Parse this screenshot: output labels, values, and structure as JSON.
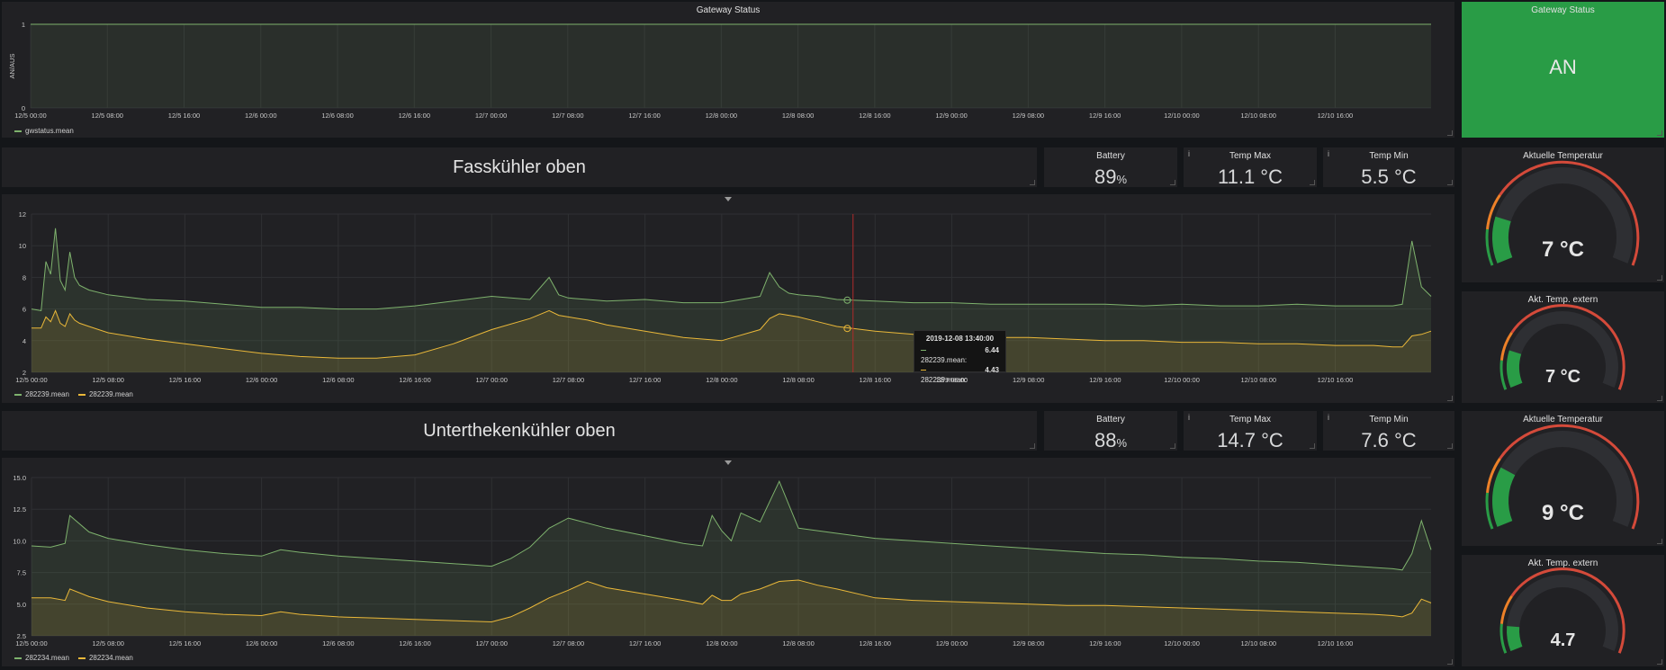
{
  "colors": {
    "green": "#7eb26d",
    "yellow": "#eab839",
    "gauge_red": "#d44a3a",
    "status_green": "#299c46"
  },
  "gateway_graph": {
    "title": "Gateway Status",
    "ylabel": "AN/AUS",
    "legend": [
      "gwstatus.mean"
    ]
  },
  "gateway_stat": {
    "title": "Gateway Status",
    "value": "AN"
  },
  "sections": [
    {
      "title": "Fasskühler oben",
      "battery": {
        "label": "Battery",
        "value": "89",
        "unit": "%"
      },
      "temp_max": {
        "label": "Temp Max",
        "value": "11.1 °C"
      },
      "temp_min": {
        "label": "Temp Min",
        "value": "5.5 °C"
      },
      "legend": [
        "282239.mean",
        "282239.mean"
      ],
      "tooltip": {
        "time": "2019-12-08 13:40:00",
        "rows": [
          {
            "name": "282239.mean:",
            "value": "6.44",
            "color": "#7eb26d"
          },
          {
            "name": "282239.mean:",
            "value": "4.43",
            "color": "#eab839"
          }
        ]
      },
      "gauge_current": {
        "title": "Aktuelle Temperatur",
        "value": "7 °C"
      },
      "gauge_external": {
        "title": "Akt. Temp. extern",
        "value": "7 °C"
      }
    },
    {
      "title": "Unterthekenkühler oben",
      "battery": {
        "label": "Battery",
        "value": "88",
        "unit": "%"
      },
      "temp_max": {
        "label": "Temp Max",
        "value": "14.7 °C"
      },
      "temp_min": {
        "label": "Temp Min",
        "value": "7.6 °C"
      },
      "legend": [
        "282234.mean",
        "282234.mean"
      ],
      "gauge_current": {
        "title": "Aktuelle Temperatur",
        "value": "9 °C"
      },
      "gauge_external": {
        "title": "Akt. Temp. extern",
        "value": "4.7"
      }
    }
  ],
  "chart_data": [
    {
      "type": "line",
      "name": "gateway-status",
      "x_ticks": [
        "12/5 00:00",
        "12/5 08:00",
        "12/5 16:00",
        "12/6 00:00",
        "12/6 08:00",
        "12/6 16:00",
        "12/7 00:00",
        "12/7 08:00",
        "12/7 16:00",
        "12/8 00:00",
        "12/8 08:00",
        "12/8 16:00",
        "12/9 00:00",
        "12/9 08:00",
        "12/9 16:00",
        "12/10 00:00",
        "12/10 08:00",
        "12/10 16:00"
      ],
      "y_ticks": [
        0,
        1
      ],
      "ylim": [
        0,
        1
      ],
      "ylabel": "AN/AUS",
      "x": [
        0,
        146
      ],
      "series": [
        {
          "values": [
            1,
            1
          ]
        }
      ]
    },
    {
      "type": "area",
      "name": "fasskuehler",
      "x_ticks": [
        "12/5 00:00",
        "12/5 08:00",
        "12/5 16:00",
        "12/6 00:00",
        "12/6 08:00",
        "12/6 16:00",
        "12/7 00:00",
        "12/7 08:00",
        "12/7 16:00",
        "12/8 00:00",
        "12/8 08:00",
        "12/8 16:00",
        "12/9 00:00",
        "12/9 08:00",
        "12/9 16:00",
        "12/10 00:00",
        "12/10 08:00",
        "12/10 16:00"
      ],
      "y_ticks": [
        2,
        4,
        6,
        8,
        10,
        12
      ],
      "ylim": [
        2,
        12
      ],
      "x": [
        0,
        1,
        1.5,
        2,
        2.5,
        3,
        3.5,
        4,
        4.5,
        5,
        6,
        8,
        12,
        16,
        20,
        24,
        28,
        32,
        36,
        40,
        44,
        48,
        52,
        54,
        55,
        56,
        58,
        60,
        64,
        68,
        72,
        76,
        77,
        78,
        79,
        80,
        82,
        84,
        88,
        92,
        96,
        100,
        104,
        108,
        112,
        116,
        120,
        124,
        128,
        132,
        136,
        140,
        142,
        143,
        144,
        145,
        146
      ],
      "series": [
        {
          "values": [
            6.0,
            5.9,
            9.0,
            8.2,
            11.1,
            7.8,
            7.2,
            9.6,
            8.0,
            7.5,
            7.2,
            6.9,
            6.6,
            6.5,
            6.3,
            6.1,
            6.1,
            6.0,
            6.0,
            6.2,
            6.5,
            6.8,
            6.6,
            8.0,
            6.9,
            6.7,
            6.6,
            6.5,
            6.6,
            6.4,
            6.4,
            6.8,
            8.3,
            7.4,
            7.0,
            6.9,
            6.8,
            6.6,
            6.5,
            6.4,
            6.4,
            6.3,
            6.3,
            6.3,
            6.3,
            6.2,
            6.3,
            6.2,
            6.2,
            6.3,
            6.2,
            6.2,
            6.2,
            6.3,
            10.3,
            7.4,
            6.8
          ]
        },
        {
          "values": [
            4.8,
            4.8,
            5.5,
            5.2,
            5.9,
            5.1,
            4.9,
            5.7,
            5.3,
            5.1,
            4.9,
            4.5,
            4.1,
            3.8,
            3.5,
            3.2,
            3.0,
            2.9,
            2.9,
            3.1,
            3.8,
            4.7,
            5.4,
            5.9,
            5.6,
            5.5,
            5.3,
            5.0,
            4.6,
            4.2,
            4.0,
            4.7,
            5.4,
            5.7,
            5.6,
            5.5,
            5.2,
            4.9,
            4.6,
            4.4,
            4.3,
            4.2,
            4.2,
            4.1,
            4.0,
            4.0,
            3.9,
            3.9,
            3.8,
            3.8,
            3.7,
            3.7,
            3.6,
            3.6,
            4.3,
            4.4,
            4.6
          ]
        }
      ],
      "crosshair_x": 85.7
    },
    {
      "type": "area",
      "name": "unterthekenkuehler",
      "x_ticks": [
        "12/5 00:00",
        "12/5 08:00",
        "12/5 16:00",
        "12/6 00:00",
        "12/6 08:00",
        "12/6 16:00",
        "12/7 00:00",
        "12/7 08:00",
        "12/7 16:00",
        "12/8 00:00",
        "12/8 08:00",
        "12/8 16:00",
        "12/9 00:00",
        "12/9 08:00",
        "12/9 16:00",
        "12/10 00:00",
        "12/10 08:00",
        "12/10 16:00"
      ],
      "y_ticks": [
        2.5,
        5.0,
        7.5,
        10.0,
        12.5,
        15.0
      ],
      "ylim": [
        2.5,
        15.0
      ],
      "x": [
        0,
        2,
        3.5,
        4,
        6,
        8,
        12,
        16,
        20,
        24,
        26,
        28,
        32,
        36,
        40,
        44,
        48,
        50,
        52,
        54,
        56,
        58,
        60,
        64,
        68,
        70,
        71,
        72,
        73,
        74,
        76,
        78,
        80,
        82,
        84,
        88,
        92,
        96,
        100,
        104,
        108,
        112,
        116,
        120,
        124,
        128,
        132,
        136,
        140,
        142,
        143,
        144,
        145,
        146
      ],
      "series": [
        {
          "values": [
            9.6,
            9.5,
            9.8,
            12.0,
            10.7,
            10.2,
            9.7,
            9.3,
            9.0,
            8.8,
            9.3,
            9.1,
            8.8,
            8.6,
            8.4,
            8.2,
            8.0,
            8.6,
            9.5,
            11.0,
            11.8,
            11.4,
            11.0,
            10.4,
            9.8,
            9.6,
            12.0,
            10.8,
            10.0,
            12.2,
            11.5,
            14.7,
            11.0,
            10.8,
            10.6,
            10.2,
            10.0,
            9.8,
            9.6,
            9.4,
            9.2,
            9.0,
            8.9,
            8.7,
            8.6,
            8.4,
            8.3,
            8.1,
            7.9,
            7.8,
            7.7,
            9.0,
            11.6,
            9.3
          ]
        },
        {
          "values": [
            5.5,
            5.5,
            5.3,
            6.2,
            5.6,
            5.2,
            4.7,
            4.4,
            4.2,
            4.1,
            4.4,
            4.2,
            4.0,
            3.9,
            3.8,
            3.7,
            3.6,
            4.0,
            4.7,
            5.5,
            6.1,
            6.8,
            6.3,
            5.8,
            5.3,
            5.0,
            5.7,
            5.3,
            5.3,
            5.8,
            6.2,
            6.8,
            6.9,
            6.5,
            6.2,
            5.5,
            5.3,
            5.2,
            5.1,
            5.0,
            4.9,
            4.9,
            4.8,
            4.7,
            4.6,
            4.5,
            4.4,
            4.3,
            4.2,
            4.1,
            4.0,
            4.3,
            5.4,
            5.1
          ]
        }
      ]
    },
    {
      "type": "gauge",
      "name": "gauge-fass-current",
      "value": 7,
      "min": 0,
      "max": 40,
      "thresholds": [
        5,
        10
      ]
    },
    {
      "type": "gauge",
      "name": "gauge-fass-external",
      "value": 7,
      "min": 0,
      "max": 40,
      "thresholds": [
        5,
        10
      ]
    },
    {
      "type": "gauge",
      "name": "gauge-unter-current",
      "value": 9,
      "min": 0,
      "max": 40,
      "thresholds": [
        5,
        10
      ]
    },
    {
      "type": "gauge",
      "name": "gauge-unter-external",
      "value": 4.7,
      "min": 0,
      "max": 40,
      "thresholds": [
        5,
        10
      ]
    }
  ]
}
